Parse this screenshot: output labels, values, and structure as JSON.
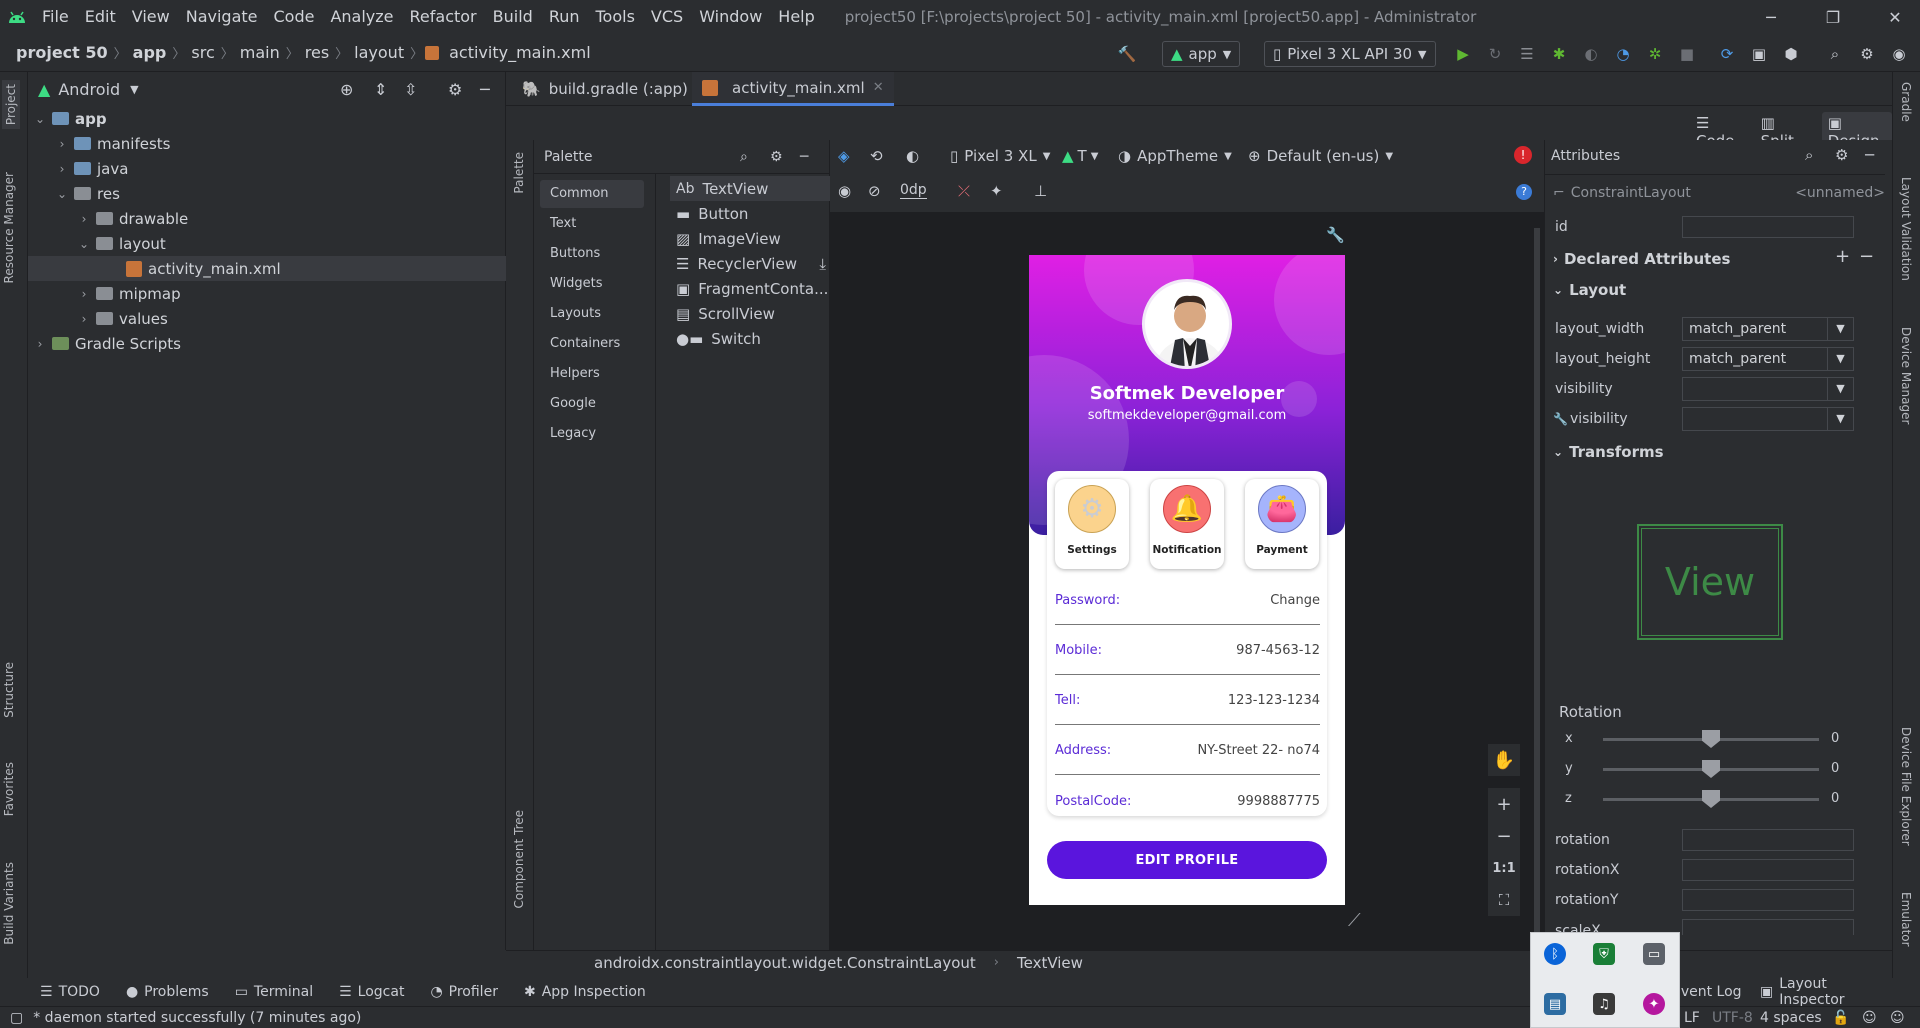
{
  "window": {
    "title": "project50 [F:\\projects\\project 50] - activity_main.xml [project50.app] - Administrator",
    "menu": [
      "File",
      "Edit",
      "View",
      "Navigate",
      "Code",
      "Analyze",
      "Refactor",
      "Build",
      "Run",
      "Tools",
      "VCS",
      "Window",
      "Help"
    ],
    "controls": {
      "minimize": "─",
      "restore": "❐",
      "close": "✕"
    }
  },
  "breadcrumb": [
    "project 50",
    "app",
    "src",
    "main",
    "res",
    "layout",
    "activity_main.xml"
  ],
  "toolbar": {
    "run_config": "app",
    "device": "Pixel 3 XL API 30"
  },
  "left_strip": {
    "project": "Project",
    "resource_manager": "Resource Manager",
    "structure": "Structure",
    "favorites": "Favorites",
    "build_variants": "Build Variants"
  },
  "right_strip": {
    "gradle": "Gradle",
    "layout_validation": "Layout Validation",
    "device_manager": "Device Manager",
    "device_file_explorer": "Device File Explorer",
    "emulator": "Emulator"
  },
  "project_panel": {
    "view_mode": "Android",
    "tree": [
      {
        "label": "app",
        "bold": true
      },
      {
        "label": "manifests"
      },
      {
        "label": "java"
      },
      {
        "label": "res"
      },
      {
        "label": "drawable"
      },
      {
        "label": "layout"
      },
      {
        "label": "activity_main.xml"
      },
      {
        "label": "mipmap"
      },
      {
        "label": "values"
      },
      {
        "label": "Gradle Scripts"
      }
    ]
  },
  "editor_tabs": [
    {
      "label": "build.gradle (:app)",
      "active": false
    },
    {
      "label": "activity_main.xml",
      "active": true
    }
  ],
  "view_modes": {
    "code": "Code",
    "split": "Split",
    "design": "Design"
  },
  "palette": {
    "title": "Palette",
    "strip_label": "Palette",
    "component_tree": "Component Tree",
    "categories": [
      "Common",
      "Text",
      "Buttons",
      "Widgets",
      "Layouts",
      "Containers",
      "Helpers",
      "Google",
      "Legacy"
    ],
    "items": [
      "TextView",
      "Button",
      "ImageView",
      "RecyclerView",
      "FragmentConta...",
      "ScrollView",
      "Switch"
    ],
    "textview_prefix": "Ab"
  },
  "design_toolbar": {
    "device": "Pixel 3 XL",
    "api": "T",
    "theme": "AppTheme",
    "locale": "Default (en-us)",
    "margin": "0dp"
  },
  "phone": {
    "name": "Softmek Developer",
    "email": "softmekdeveloper@gmail.com",
    "tiles": [
      {
        "label": "Settings",
        "icon": "settings-gear-icon",
        "color": "#fbd38d"
      },
      {
        "label": "Notification",
        "icon": "bell-icon",
        "color": "#f87171"
      },
      {
        "label": "Payment",
        "icon": "wallet-icon",
        "color": "#a5b4fc"
      }
    ],
    "rows": [
      {
        "key": "Password:",
        "value": "Change"
      },
      {
        "key": "Mobile:",
        "value": "987-4563-12"
      },
      {
        "key": "Tell:",
        "value": "123-123-1234"
      },
      {
        "key": "Address:",
        "value": "NY-Street 22- no74"
      },
      {
        "key": "PostalCode:",
        "value": "9998887775"
      }
    ],
    "button": "EDIT PROFILE",
    "accent": "#5a15dd"
  },
  "zoom": {
    "plus": "+",
    "minus": "−",
    "one": "1:1"
  },
  "attributes": {
    "title": "Attributes",
    "component": "ConstraintLayout",
    "component_name": "<unnamed>",
    "id_label": "id",
    "declared": "Declared Attributes",
    "layout": "Layout",
    "layout_width": {
      "label": "layout_width",
      "value": "match_parent"
    },
    "layout_height": {
      "label": "layout_height",
      "value": "match_parent"
    },
    "visibility": "visibility",
    "tools_visibility": "visibility",
    "transforms": "Transforms",
    "preview": "View",
    "rotation_title": "Rotation",
    "rotation_axes": [
      {
        "axis": "x",
        "value": "0"
      },
      {
        "axis": "y",
        "value": "0"
      },
      {
        "axis": "z",
        "value": "0"
      }
    ],
    "props": [
      "rotation",
      "rotationX",
      "rotationY",
      "scaleX"
    ]
  },
  "component_path": [
    "androidx.constraintlayout.widget.ConstraintLayout",
    "TextView"
  ],
  "tool_windows": [
    "TODO",
    "Problems",
    "Terminal",
    "Logcat",
    "Profiler",
    "App Inspection"
  ],
  "tool_windows_right": [
    "Event Log",
    "Layout Inspector"
  ],
  "status": {
    "message": "* daemon started successfully (7 minutes ago)",
    "line_sep": "LF",
    "encoding": "UTF-8",
    "indent": "4 spaces"
  }
}
